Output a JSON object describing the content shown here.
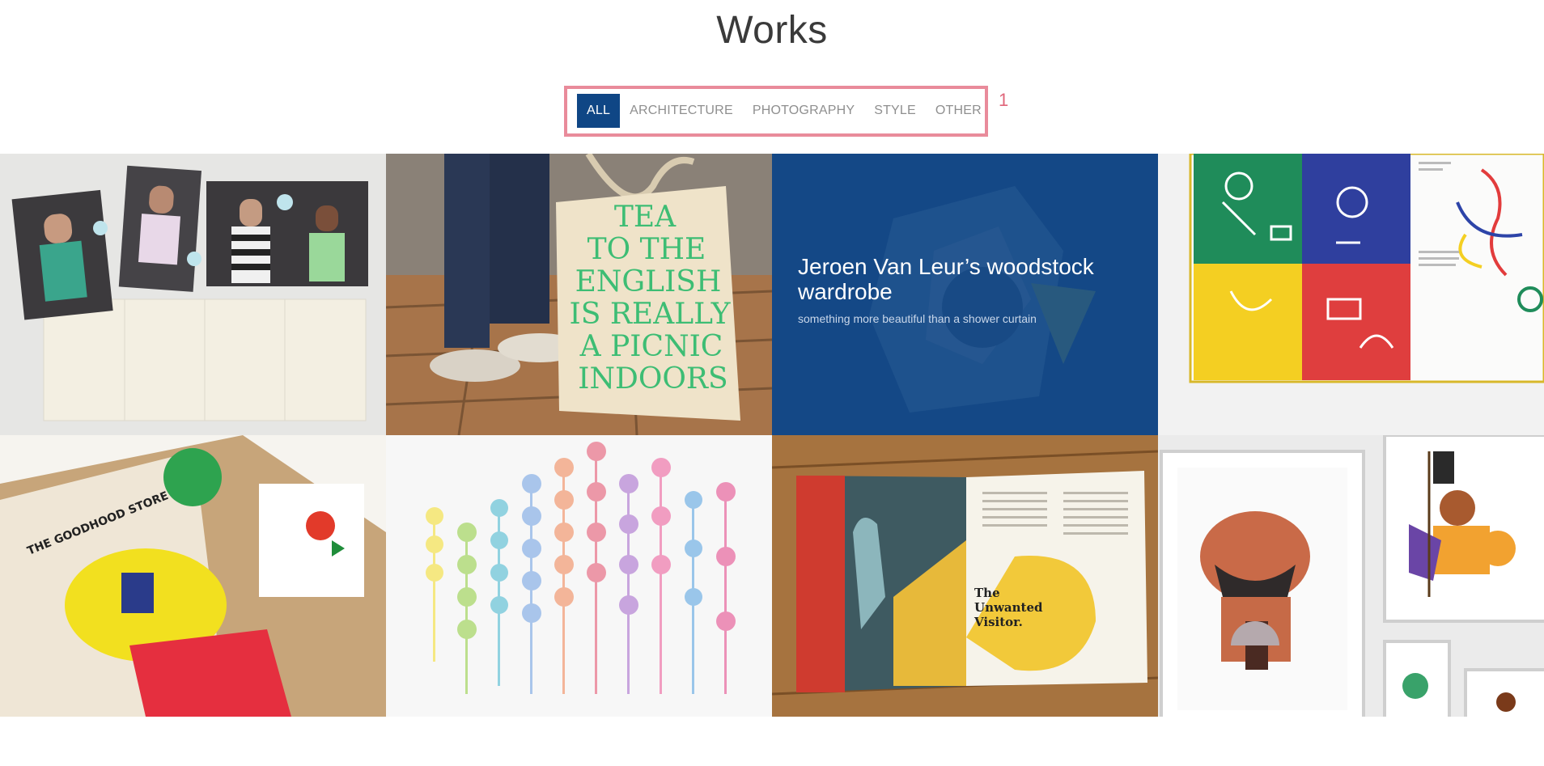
{
  "page": {
    "title": "Works"
  },
  "filters": {
    "marker": "1",
    "items": [
      {
        "label": "ALL",
        "active": true
      },
      {
        "label": "ARCHITECTURE",
        "active": false
      },
      {
        "label": "PHOTOGRAPHY",
        "active": false
      },
      {
        "label": "STYLE",
        "active": false
      },
      {
        "label": "OTHER",
        "active": false
      }
    ]
  },
  "tote_text": [
    "TEA",
    "TO THE",
    "ENGLISH",
    "IS REALLY",
    "A PICNIC",
    "INDOORS"
  ],
  "book_text": [
    "The",
    "Unwanted",
    "Visitor."
  ],
  "portfolio": {
    "hover_item": {
      "title": "Jeroen Van Leur’s woodstock wardrobe",
      "subtitle": "something more beautiful than a shower curtain"
    }
  },
  "colors": {
    "accent": "#0f4685",
    "highlight_box": "#e98b9b",
    "title_text": "#3a3a3a",
    "filter_text": "#8f8f8f"
  }
}
